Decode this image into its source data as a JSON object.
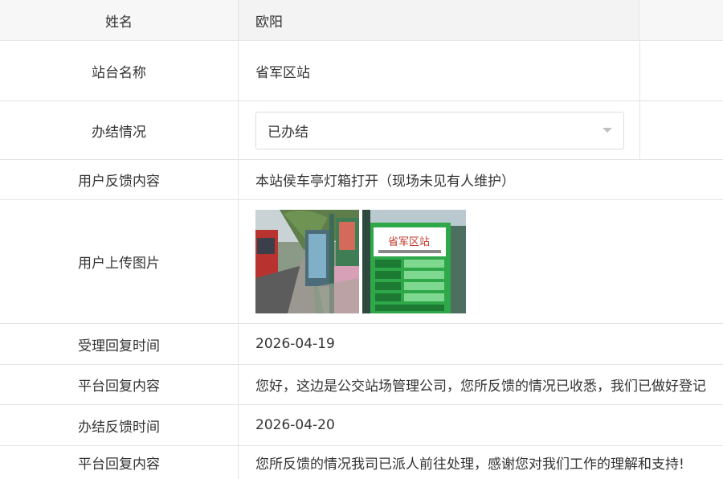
{
  "rows": {
    "name": {
      "label": "姓名",
      "value": "欧阳"
    },
    "station": {
      "label": "站台名称",
      "value": "省军区站"
    },
    "status": {
      "label": "办结情况",
      "value": "已办结"
    },
    "feedback": {
      "label": "用户反馈内容",
      "value": "本站侯车亭灯箱打开（现场未见有人维护）"
    },
    "images": {
      "label": "用户上传图片"
    },
    "accept_time": {
      "label": "受理回复时间",
      "value": "2026-04-19"
    },
    "reply1": {
      "label": "平台回复内容",
      "value": "您好，这边是公交站场管理公司，您所反馈的情况已收悉，我们已做好登记"
    },
    "finish_time": {
      "label": "办结反馈时间",
      "value": "2026-04-20"
    },
    "reply2": {
      "label": "平台回复内容",
      "value": "您所反馈的情况我司已派人前往处理，感谢您对我们工作的理解和支持!"
    }
  },
  "photo_sign": {
    "title": "省军区站"
  },
  "colors": {
    "border": "#e4e4e4",
    "label_bg": "#f7f7f7",
    "text": "#333333"
  }
}
